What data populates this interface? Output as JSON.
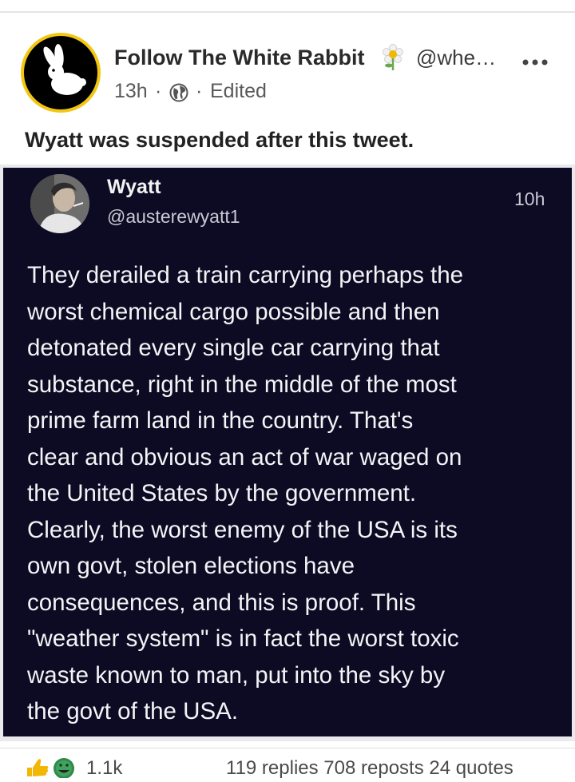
{
  "post": {
    "author_name": "Follow The White Rabbit",
    "author_handle": "@whe…",
    "time": "13h",
    "separator": "·",
    "status": "Edited",
    "caption": "Wyatt was suspended after this tweet.",
    "icons": {
      "avatar": "white-rabbit-logo",
      "badge": "flower-emoji",
      "privacy": "globe-icon",
      "menu": "more-options-icon"
    },
    "colors": {
      "avatar_ring": "#f3c711"
    }
  },
  "tweet": {
    "name": "Wyatt",
    "handle": "@austerewyatt1",
    "time": "10h",
    "body_lines": [
      "They derailed a train carrying perhaps the",
      "worst chemical cargo possible and then",
      "detonated every single car carrying that",
      "substance, right in the middle of the most",
      "prime farm land in the country. That's",
      "clear and obvious an act of war waged on",
      "the United States by the government.",
      "Clearly, the worst enemy of the USA is its",
      "own govt, stolen elections have",
      "consequences, and this is proof. This",
      "\"weather system\" is in fact the worst toxic",
      "waste known to man, put into the sky by",
      "the govt of the USA."
    ],
    "colors": {
      "background": "#0d0a24",
      "text": "#f4f4f6"
    }
  },
  "footer": {
    "reactions_count": "1.1k",
    "stats": "119 replies  708 reposts  24 quotes",
    "reaction_icons": [
      "thumbs-up-icon",
      "laughing-emoji-icon"
    ]
  }
}
